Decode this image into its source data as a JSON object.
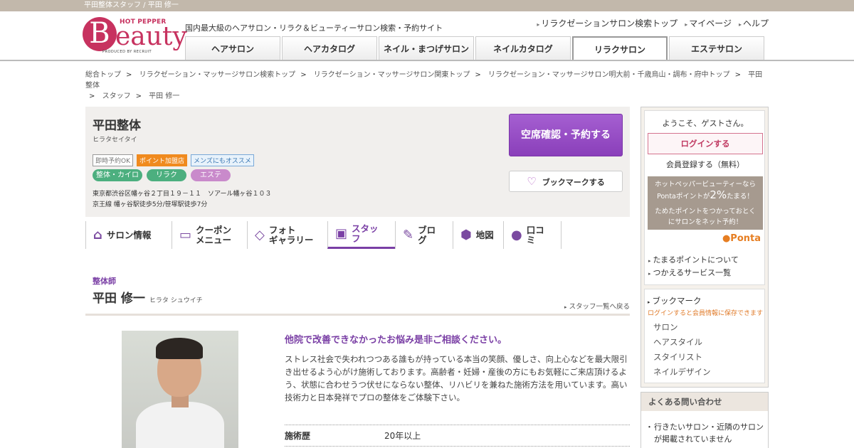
{
  "topbar": {
    "text": "平田整体スタッフ / 平田 修一"
  },
  "logo": {
    "hotpepper": "HOT PEPPER",
    "b": "B",
    "eauty": "eauty",
    "produced": "PRODUCED BY RECRUIT"
  },
  "header": {
    "tagline": "国内最大級のヘアサロン・リラク＆ビューティーサロン検索・予約サイト",
    "links": [
      "リラクゼーションサロン検索トップ",
      "マイページ",
      "ヘルプ"
    ],
    "tabs": [
      "ヘアサロン",
      "ヘアカタログ",
      "ネイル・まつげサロン",
      "ネイルカタログ",
      "リラクサロン",
      "エステサロン"
    ]
  },
  "breadcrumb": [
    "総合トップ",
    "リラクゼーション・マッサージサロン検索トップ",
    "リラクゼーション・マッサージサロン関東トップ",
    "リラクゼーション・マッサージサロン明大前・千歳烏山・調布・府中トップ",
    "平田整体",
    "スタッフ",
    "平田 修一"
  ],
  "salon": {
    "name": "平田整体",
    "kana": "ヒラタセイタイ",
    "badges": [
      "即時予約OK",
      "ポイント加盟店",
      "メンズにもオススメ"
    ],
    "categories": [
      "整体・カイロ",
      "リラク",
      "エステ"
    ],
    "address": "東京都渋谷区幡ヶ谷２丁目１９－１１　ソアール幡ヶ谷１０３",
    "access": "京王線 幡ヶ谷駅徒歩5分/笹塚駅徒歩7分",
    "reserve_label": "空席確認・予約する",
    "bookmark_label": "ブックマークする"
  },
  "subnav": [
    {
      "l1": "サロン情報",
      "l2": ""
    },
    {
      "l1": "クーポン",
      "l2": "メニュー"
    },
    {
      "l1": "フォト",
      "l2": "ギャラリー"
    },
    {
      "l1": "スタッフ",
      "l2": ""
    },
    {
      "l1": "ブログ",
      "l2": ""
    },
    {
      "l1": "地図",
      "l2": ""
    },
    {
      "l1": "口コミ",
      "l2": ""
    }
  ],
  "staff": {
    "role": "整体師",
    "name": "平田 修一",
    "kana": "ヒラタ シュウイチ",
    "back_link": "スタッフ一覧へ戻る",
    "catch": "他院で改善できなかったお悩み是非ご相談ください。",
    "description": "ストレス社会で失われつつある誰もが持っている本当の笑顔、優しさ、向上心などを最大限引き出せるよう心がけ施術しております。高齢者・妊婦・産後の方にもお気軽にご来店頂けるよう、状態に合わせうつ伏せにならない整体、リハビリを兼ねた施術方法を用いています。高い技術力と日本発祥でプロの整体をご体験下さい。",
    "experience_label": "施術歴",
    "experience_value": "20年以上"
  },
  "sidebar": {
    "welcome": "ようこそ、ゲストさん。",
    "login": "ログインする",
    "register": "会員登録する（無料）",
    "ponta_line1": "ホットペッパービューティーなら",
    "ponta_line2a": "Pontaポイントが",
    "ponta_pct": "2%",
    "ponta_line2b": "たまる！",
    "ponta_line3": "ためたポイントをつかっておとく",
    "ponta_line4": "にサロンをネット予約！",
    "ponta_logo": "Ponta",
    "links": [
      "たまるポイントについて",
      "つかえるサービス一覧"
    ],
    "bookmark_title": "ブックマーク",
    "bookmark_note": "ログインすると会員情報に保存できます",
    "bookmark_items": [
      "サロン",
      "ヘアスタイル",
      "スタイリスト",
      "ネイルデザイン"
    ],
    "faq_title": "よくある問い合わせ",
    "faq_text": "行きたいサロン・近隣のサロンが掲載されていません"
  }
}
